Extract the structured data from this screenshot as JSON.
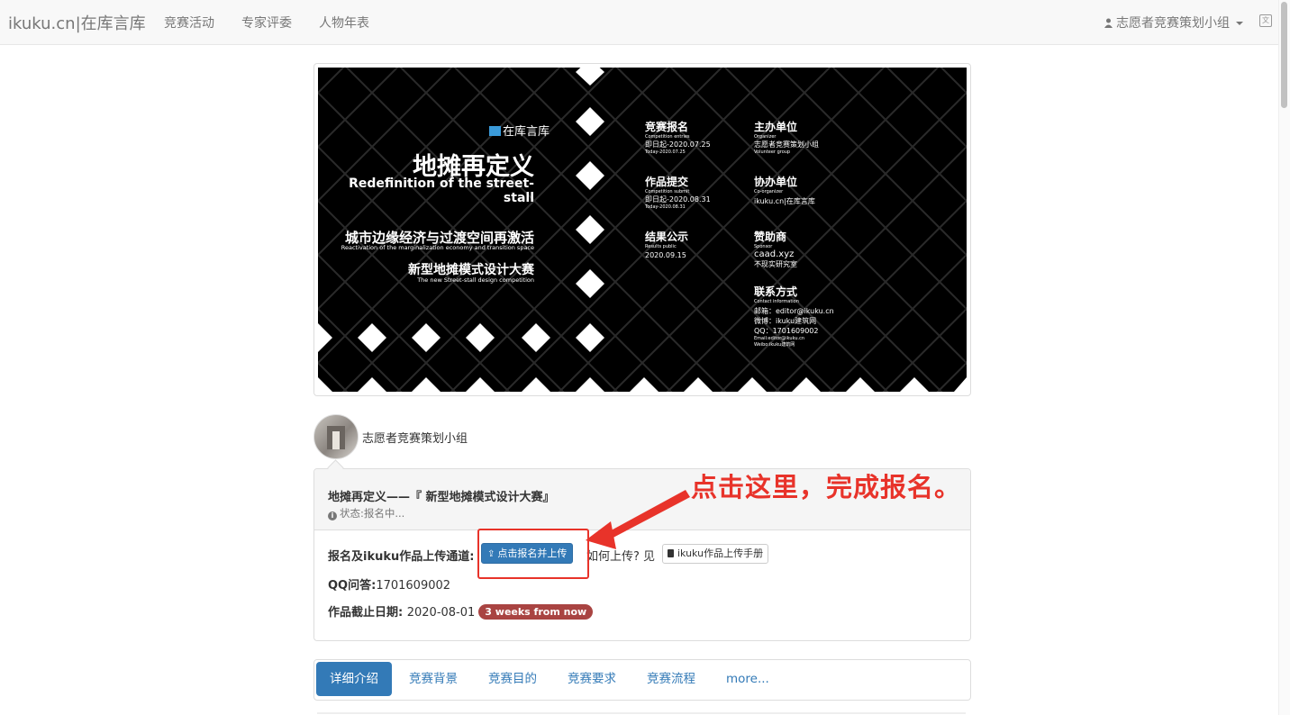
{
  "navbar": {
    "brand": "ikuku.cn|在库言库",
    "items": [
      "竞赛活动",
      "专家评委",
      "人物年表"
    ],
    "user_label": "志愿者竞赛策划小组"
  },
  "banner": {
    "brand": "在库言库",
    "title": "地摊再定义",
    "title_en": "Redefinition of the street-stall",
    "subtitle1": "城市边缘经济与过渡空间再激活",
    "subtitle1_en": "Reactivation of the marginalization economy and transition space",
    "subtitle2": "新型地摊模式设计大赛",
    "subtitle2_en": "The new Street-stall design competition",
    "entries": {
      "h": "竞赛报名",
      "s": "Competition entries",
      "v": "即日起-2020.07.25",
      "c": "Today-2020.07.25"
    },
    "submit": {
      "h": "作品提交",
      "s": "Competition submit",
      "v": "即日起-2020.08.31",
      "c": "Today-2020.08.31"
    },
    "results": {
      "h": "结果公示",
      "s": "Results public",
      "v": "2020.09.15"
    },
    "organizer": {
      "h": "主办单位",
      "s": "Organizer",
      "v": "志愿者竞赛策划小组",
      "c": "Volunteer group"
    },
    "coorganizer": {
      "h": "协办单位",
      "s": "Co-organizer",
      "v": "ikuku.cn|在库言库"
    },
    "sponsor": {
      "h": "赞助商",
      "s": "Sponsor",
      "v": "caad.xyz",
      "c": "不现实研究室"
    },
    "contact": {
      "h": "联系方式",
      "s": "Contact information",
      "l1": "邮箱：editor@ikuku.cn",
      "l2": "微博：ikuku建筑网",
      "l3": "QQ：1701609002",
      "l4": "Email:editor@ikuku.cn",
      "l5": "Weibo:ikuku建筑网"
    }
  },
  "author": {
    "name": "志愿者竞赛策划小组"
  },
  "panel": {
    "title": "地摊再定义——『 新型地摊模式设计大赛』",
    "status": "状态:报名中...",
    "upload_label": "报名及ikuku作品上传通道:",
    "signup_button": "点击报名并上传",
    "how_text": "如何上传? 见",
    "manual_button": "ikuku作品上传手册",
    "qq_label": "QQ问答:",
    "qq_value": "1701609002",
    "deadline_label": "作品截止日期:",
    "deadline_value": "2020-08-01",
    "deadline_badge": "3 weeks from now"
  },
  "annotation": {
    "text": "点击这里，完成报名。",
    "color": "#e8332a"
  },
  "tabs": [
    "详细介绍",
    "竞赛背景",
    "竞赛目的",
    "竞赛要求",
    "竞赛流程",
    "more..."
  ],
  "colors": {
    "primary": "#337ab7",
    "danger": "#a94442",
    "navbar_bg": "#f8f8f8"
  }
}
